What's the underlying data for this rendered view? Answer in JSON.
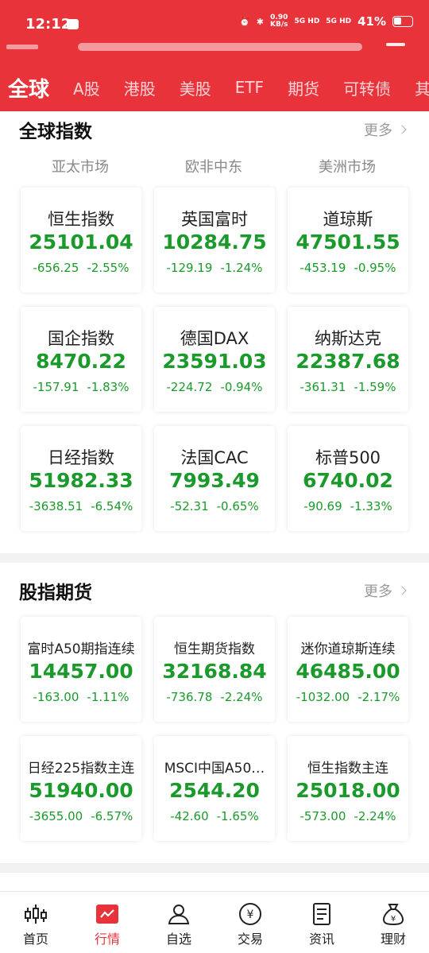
{
  "status": {
    "time": "12:12",
    "speed_top": "0.90",
    "speed_unit": "KB/s",
    "net1": "5G HD",
    "net2": "5G HD",
    "battery": "41%"
  },
  "tabs": [
    "全球",
    "A股",
    "港股",
    "美股",
    "ETF",
    "期货",
    "可转债",
    "其他"
  ],
  "global": {
    "title": "全球指数",
    "more": "更多",
    "regions": [
      "亚太市场",
      "欧非中东",
      "美洲市场"
    ],
    "tiles": [
      {
        "name": "恒生指数",
        "value": "25101.04",
        "change": "-656.25",
        "pct": "-2.55%"
      },
      {
        "name": "英国富时",
        "value": "10284.75",
        "change": "-129.19",
        "pct": "-1.24%"
      },
      {
        "name": "道琼斯",
        "value": "47501.55",
        "change": "-453.19",
        "pct": "-0.95%"
      },
      {
        "name": "国企指数",
        "value": "8470.22",
        "change": "-157.91",
        "pct": "-1.83%"
      },
      {
        "name": "德国DAX",
        "value": "23591.03",
        "change": "-224.72",
        "pct": "-0.94%"
      },
      {
        "name": "纳斯达克",
        "value": "22387.68",
        "change": "-361.31",
        "pct": "-1.59%"
      },
      {
        "name": "日经指数",
        "value": "51982.33",
        "change": "-3638.51",
        "pct": "-6.54%"
      },
      {
        "name": "法国CAC",
        "value": "7993.49",
        "change": "-52.31",
        "pct": "-0.65%"
      },
      {
        "name": "标普500",
        "value": "6740.02",
        "change": "-90.69",
        "pct": "-1.33%"
      }
    ]
  },
  "futures": {
    "title": "股指期货",
    "more": "更多",
    "tiles": [
      {
        "name": "富时A50期指连续",
        "value": "14457.00",
        "change": "-163.00",
        "pct": "-1.11%"
      },
      {
        "name": "恒生期货指数",
        "value": "32168.84",
        "change": "-736.78",
        "pct": "-2.24%"
      },
      {
        "name": "迷你道琼斯连续",
        "value": "46485.00",
        "change": "-1032.00",
        "pct": "-2.17%"
      },
      {
        "name": "日经225指数主连",
        "value": "51940.00",
        "change": "-3655.00",
        "pct": "-6.57%"
      },
      {
        "name": "MSCI中国A50…",
        "value": "2544.20",
        "change": "-42.60",
        "pct": "-1.65%"
      },
      {
        "name": "恒生指数主连",
        "value": "25018.00",
        "change": "-573.00",
        "pct": "-2.24%"
      }
    ]
  },
  "nav": [
    {
      "label": "首页",
      "icon": "candlestick-icon"
    },
    {
      "label": "行情",
      "icon": "chart-icon"
    },
    {
      "label": "自选",
      "icon": "user-star-icon"
    },
    {
      "label": "交易",
      "icon": "yen-coin-icon"
    },
    {
      "label": "资讯",
      "icon": "document-icon"
    },
    {
      "label": "理财",
      "icon": "money-bag-icon"
    }
  ],
  "colors": {
    "brand": "#e8333b",
    "down": "#1a9a2a"
  }
}
